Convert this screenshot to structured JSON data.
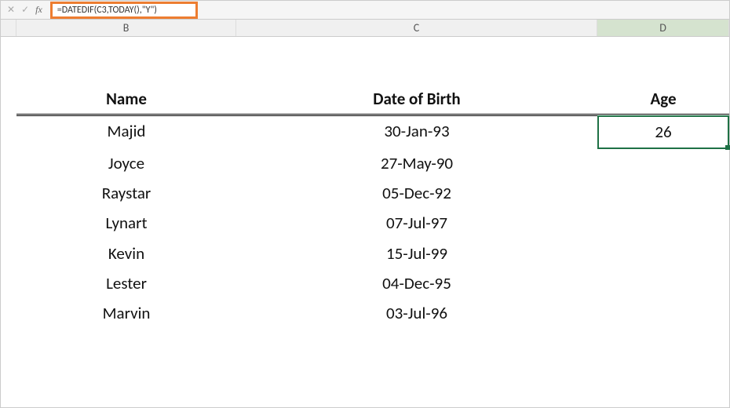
{
  "formula_bar": {
    "cancel_icon": "✕",
    "enter_icon": "✓",
    "fx_label": "fx",
    "formula": "=DATEDIF(C3,TODAY(),\"Y\")"
  },
  "columns": {
    "b": "B",
    "c": "C",
    "d": "D"
  },
  "headers": {
    "name": "Name",
    "dob": "Date of Birth",
    "age": "Age"
  },
  "rows": [
    {
      "name": "Majid",
      "dob": "30-Jan-93",
      "age": "26"
    },
    {
      "name": "Joyce",
      "dob": "27-May-90",
      "age": ""
    },
    {
      "name": "Raystar",
      "dob": "05-Dec-92",
      "age": ""
    },
    {
      "name": "Lynart",
      "dob": "07-Jul-97",
      "age": ""
    },
    {
      "name": "Kevin",
      "dob": "15-Jul-99",
      "age": ""
    },
    {
      "name": "Lester",
      "dob": "04-Dec-95",
      "age": ""
    },
    {
      "name": "Marvin",
      "dob": "03-Jul-96",
      "age": ""
    }
  ],
  "active_cell": {
    "row": 0,
    "col": "d"
  }
}
